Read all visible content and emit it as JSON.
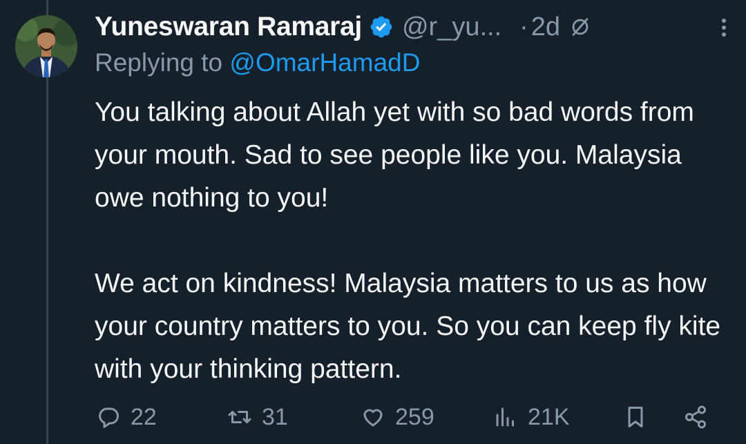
{
  "tweet": {
    "author_name": "Yuneswaran Ramaraj",
    "handle": "@r_yu...",
    "separator": "·",
    "time": "2d",
    "replying_prefix": "Replying to ",
    "replying_to": "@OmarHamadD",
    "paragraphs": [
      "You talking about Allah yet with so bad words from your mouth. Sad to see people like you. Malaysia owe nothing to you!",
      "We act on kindness! Malaysia matters to us as how your country matters to you. So you can keep fly kite with your thinking pattern."
    ]
  },
  "actions": {
    "replies": "22",
    "retweets": "31",
    "likes": "259",
    "views": "21K"
  },
  "icons": [
    "verified-badge-icon",
    "edited-icon",
    "more-icon",
    "reply-icon",
    "retweet-icon",
    "like-icon",
    "views-icon",
    "bookmark-icon",
    "share-icon"
  ],
  "colors": {
    "background": "#15202b",
    "text": "#f7f9f9",
    "secondary": "#8b98a5",
    "accent": "#1d9bf0"
  }
}
